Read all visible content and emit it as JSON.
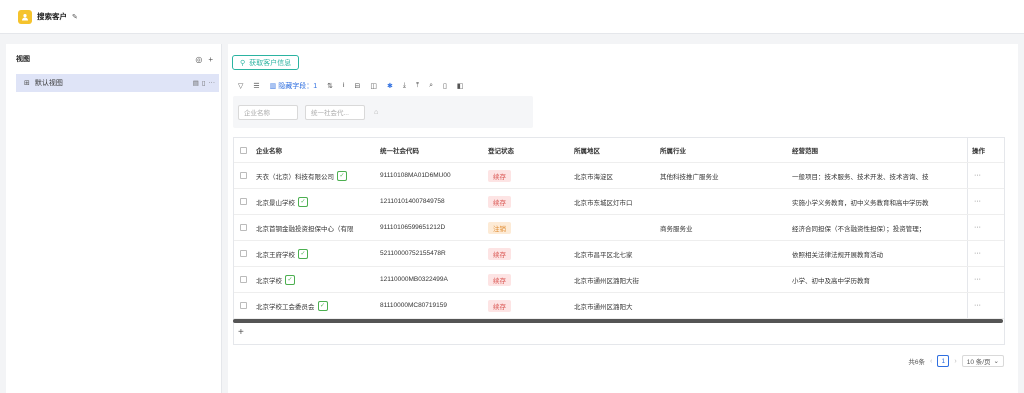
{
  "header": {
    "title": "搜索客户",
    "app_icon": "person-icon",
    "edit_icon": "pencil-icon"
  },
  "sidebar": {
    "title": "视图",
    "default_view": "默认视图"
  },
  "main": {
    "fetch_button": "获取客户信息",
    "toolbar": {
      "hidden_fields": "隐藏字段：1"
    },
    "filters": [
      {
        "placeholder": "企业名称"
      },
      {
        "placeholder": "统一社会代..."
      }
    ]
  },
  "table": {
    "headers": {
      "name": "企业名称",
      "code": "统一社会代码",
      "status": "登记状态",
      "area": "所属地区",
      "industry": "所属行业",
      "scope": "经营范围",
      "op": "操作"
    },
    "rows": [
      {
        "name": "天衣（北京）科技有限公司",
        "verified": true,
        "code": "91110108MA01D6MU00",
        "status": "续存",
        "status_type": "active",
        "area": "北京市海淀区",
        "industry": "其他科技推广服务业",
        "scope": "一般项目：技术服务、技术开发、技术咨询、技",
        "op": "···"
      },
      {
        "name": "北京景山学校",
        "verified": true,
        "code": "121101014007849758",
        "status": "续存",
        "status_type": "active",
        "area": "北京市东城区灯市口",
        "industry": "",
        "scope": "实施小学义务教育，初中义务教育和高中学历教",
        "op": "···"
      },
      {
        "name": "北京首钢金融投资担保中心（有限",
        "verified": false,
        "code": "91110106599651212D",
        "status": "注销",
        "status_type": "cancelled",
        "area": "",
        "industry": "商务服务业",
        "scope": "经济合同担保（不含融资性担保）；投资管理；",
        "op": "···"
      },
      {
        "name": "北京王府学校",
        "verified": true,
        "code": "52110000752155478R",
        "status": "续存",
        "status_type": "active",
        "area": "北京市昌平区北七家",
        "industry": "",
        "scope": "依照相关法律法规开展教育活动",
        "op": "···"
      },
      {
        "name": "北京学校",
        "verified": true,
        "code": "12110000MB0322499A",
        "status": "续存",
        "status_type": "active",
        "area": "北京市通州区潞阳大街",
        "industry": "",
        "scope": "小学、初中及高中学历教育",
        "op": "···"
      },
      {
        "name": "北京学校工会委员会",
        "verified": true,
        "code": "81110000MC80719159",
        "status": "续存",
        "status_type": "active",
        "area": "北京市通州区潞阳大",
        "industry": "",
        "scope": "",
        "op": "···"
      }
    ]
  },
  "pager": {
    "total": "共6条",
    "page": "1",
    "page_size": "10 条/页"
  }
}
